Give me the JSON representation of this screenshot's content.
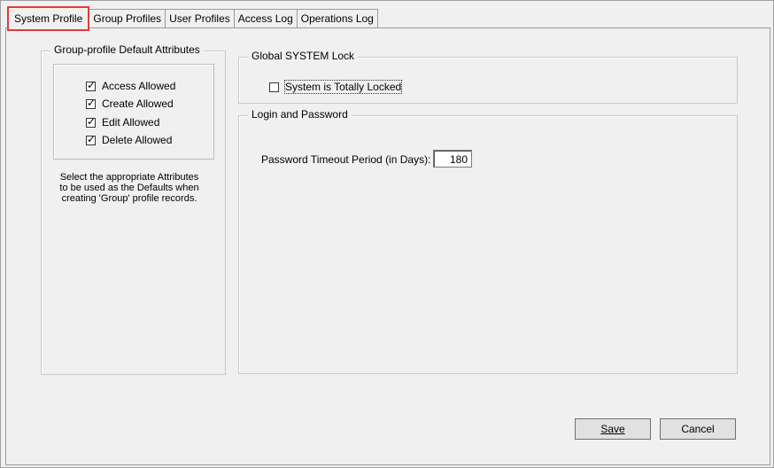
{
  "tabs": [
    "System Profile",
    "Group Profiles",
    "User Profiles",
    "Access Log",
    "Operations Log"
  ],
  "group_profile": {
    "title": "Group-profile Default Attributes",
    "attributes": [
      {
        "label": "Access Allowed",
        "checked": true
      },
      {
        "label": "Create Allowed",
        "checked": true
      },
      {
        "label": "Edit Allowed",
        "checked": true
      },
      {
        "label": "Delete Allowed",
        "checked": true
      }
    ],
    "hint_lines": [
      "Select the appropriate Attributes",
      "to be used as the Defaults when",
      "creating 'Group' profile records."
    ]
  },
  "global_lock": {
    "title": "Global SYSTEM Lock",
    "checkbox_label": "System is Totally Locked",
    "checked": false
  },
  "login": {
    "title": "Login and Password",
    "timeout_label": "Password Timeout Period (in Days):",
    "timeout_value": "180"
  },
  "buttons": {
    "save": "Save",
    "cancel": "Cancel"
  }
}
